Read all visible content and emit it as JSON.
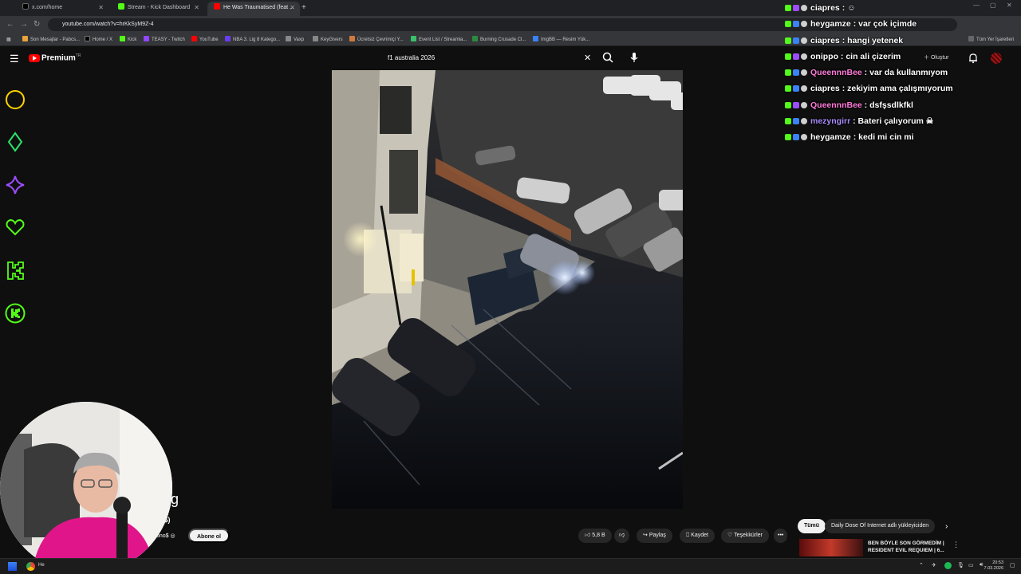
{
  "browser": {
    "tabs": [
      {
        "title": "x.com/home",
        "active": false
      },
      {
        "title": "Stream - Kick Dashboard",
        "active": false
      },
      {
        "title": "He Was Traumatised (feat ...",
        "active": true
      }
    ],
    "new_tab": "+",
    "url": "youtube.com/watch?v=hrKkSyM9Z-4",
    "bookmarks": [
      "Son Mesajlar - Pabcs...",
      "Home / X",
      "Kick",
      "TEASY - Twitch",
      "YouTube",
      "NBA 3. Lig 8 Katego...",
      "Vaxp",
      "KeyGivers",
      "Ücretsiz Çevrimiçi Y...",
      "Event List / Streamla...",
      "Burning Crusade Cl...",
      "ImgBB — Resim Yük..."
    ],
    "bookmarks_right": "Tüm Yer İşaretleri"
  },
  "youtube": {
    "brand": "Premium",
    "brand_sup": "TR",
    "search_value": "f1 australia 2026",
    "create_label": "Oluştur",
    "title_fragment": "g",
    "channel_line1": "o$)",
    "channel_line2": "ono$",
    "subscribe_label": "Abone ol",
    "like_count": "5,8 B",
    "share_label": "Paylaş",
    "save_label": "Kaydet",
    "thanks_label": "Teşekkürler",
    "more_label": "•••",
    "chips": [
      "Tümü",
      "Daily Dose Of Internet adlı yükleyiciden"
    ],
    "rec_title_1": "BEN BÖYLE SON GÖRMEDİM |",
    "rec_title_2": "RESIDENT EVIL REQUIEM | 6..."
  },
  "chat": [
    {
      "user": "ciapres",
      "color": "#ffffff",
      "msg": "☺"
    },
    {
      "user": "heygamze",
      "color": "#ffffff",
      "msg": "var çok içimde"
    },
    {
      "user": "ciapres",
      "color": "#ffffff",
      "msg": "hangi yetenek"
    },
    {
      "user": "onippo",
      "color": "#ffffff",
      "msg": "cin ali çizerim"
    },
    {
      "user": "QueennnBee",
      "color": "#ff7ad9",
      "msg": "var da kullanmıyom"
    },
    {
      "user": "ciapres",
      "color": "#ffffff",
      "msg": "zekiyim ama çalışmıyorum"
    },
    {
      "user": "QueennnBee",
      "color": "#ff7ad9",
      "msg": "dsfşsdlkfkl"
    },
    {
      "user": "mezyngirr",
      "color": "#a78bfa",
      "msg": "Bateri çalıyorum ☠"
    },
    {
      "user": "heygamze",
      "color": "#ffffff",
      "msg": "kedi mi cin mi"
    }
  ],
  "overlay_icons": [
    "circle-icon",
    "diamond-icon",
    "star-icon",
    "heart-icon",
    "kick-k-icon",
    "kick-badge-icon"
  ],
  "taskbar": {
    "time": "20:53",
    "date": "7.03.2026",
    "app_label": "He"
  },
  "colors": {
    "accent_green": "#53fc18",
    "yt_red": "#ff0000",
    "overlay_yellow": "#ffd400",
    "overlay_purple": "#9b4dff"
  }
}
